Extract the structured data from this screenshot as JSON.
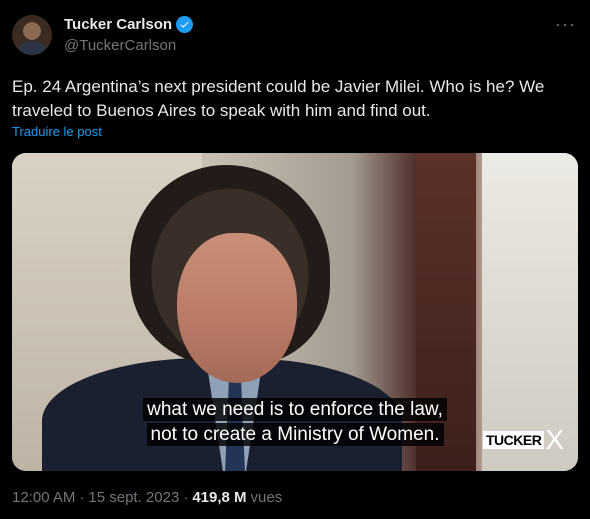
{
  "author": {
    "name": "Tucker Carlson",
    "handle": "@TuckerCarlson",
    "verified": true,
    "avatar": "avatar"
  },
  "menu": {
    "more_icon": "more-icon",
    "glyph": "···"
  },
  "tweet": {
    "text": "Ep. 24  Argentina’s next president could be Javier Milei. Who is he? We traveled to Buenos Aires to speak with him and find out.",
    "translate_label": "Traduire le post"
  },
  "media": {
    "subtitle_line1": "what we need is to enforce the law,",
    "subtitle_line2": "not to create a Ministry of Women.",
    "brand_text": "TUCKER",
    "brand_x": "X"
  },
  "meta": {
    "time": "12:00 AM",
    "separator1": "·",
    "date": "15 sept. 2023",
    "separator2": "·",
    "views_count": "419,8 M",
    "views_label": "vues"
  },
  "colors": {
    "background": "#000000",
    "primary_text": "#e7e9ea",
    "secondary_text": "#71767b",
    "accent": "#1d9bf0"
  }
}
